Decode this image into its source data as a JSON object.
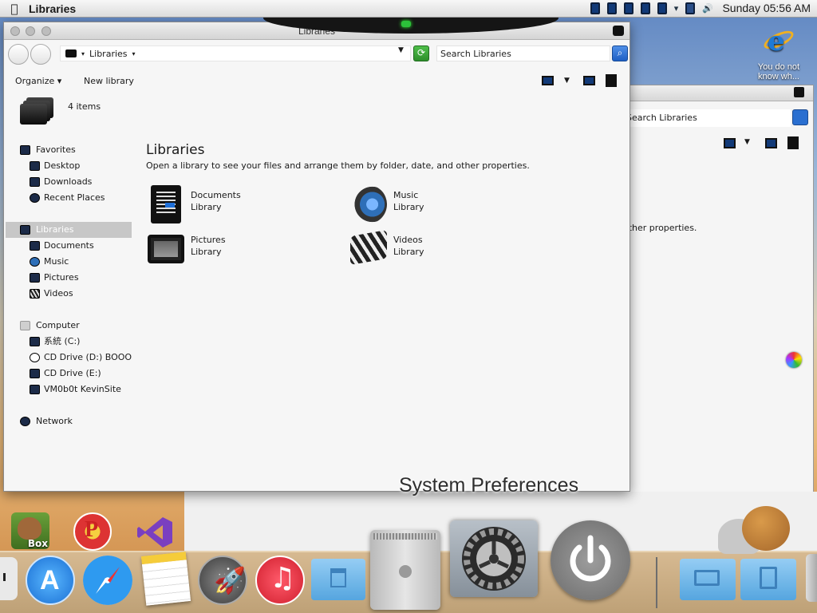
{
  "menubar": {
    "app_name": "Libraries",
    "clock": "Sunday 05:56 AM",
    "apple": ""
  },
  "desktop": {
    "ie_label": "You do not know wh..."
  },
  "window": {
    "title": "Libraries",
    "breadcrumb": "Libraries",
    "search_placeholder": "Search Libraries",
    "toolbar": {
      "organize": "Organize",
      "new_library": "New library"
    },
    "item_count": "4 items",
    "heading": "Libraries",
    "description": "Open a library to see your files and arrange them by folder, date, and other properties.",
    "libraries": [
      {
        "name": "Documents",
        "type": "Library",
        "icon": "documents-icon"
      },
      {
        "name": "Music",
        "type": "Library",
        "icon": "music-icon"
      },
      {
        "name": "Pictures",
        "type": "Library",
        "icon": "pictures-icon"
      },
      {
        "name": "Videos",
        "type": "Library",
        "icon": "videos-icon"
      }
    ]
  },
  "sidebar": {
    "favorites": "Favorites",
    "favorites_items": [
      "Desktop",
      "Downloads",
      "Recent Places"
    ],
    "libraries": "Libraries",
    "libraries_items": [
      "Documents",
      "Music",
      "Pictures",
      "Videos"
    ],
    "computer": "Computer",
    "computer_items": [
      "系統 (C:)",
      "CD Drive (D:) BOOOM",
      "CD Drive (E:)",
      "VM0b0t KevinSite"
    ],
    "network": "Network"
  },
  "background_window": {
    "search_text": "Search Libraries",
    "partial_desc": "other properties."
  },
  "dock": {
    "hover_label": "System Preferences",
    "box_label": "Box",
    "items": [
      "Finder",
      "App Store",
      "Safari",
      "Notes",
      "Launchpad",
      "iTunes",
      "Applications",
      "Mac Pro",
      "System Preferences",
      "Shut Down",
      "Documents",
      "Downloads",
      "Trash"
    ]
  },
  "colors": {
    "accent": "#1e6fd8",
    "selection": "#c7c7c7"
  }
}
